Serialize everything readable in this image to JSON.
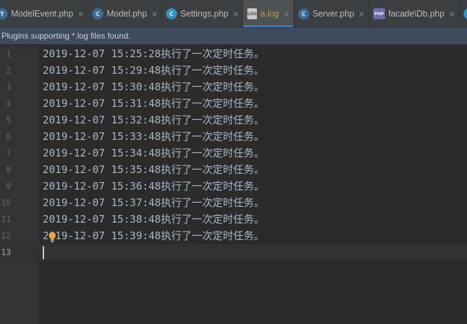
{
  "tabs": [
    {
      "label": "ModelEvent.php",
      "icon": "php-class-icon",
      "badge": "T",
      "active": false
    },
    {
      "label": "Model.php",
      "icon": "php-class-icon",
      "badge": "C",
      "active": false
    },
    {
      "label": "Settings.php",
      "icon": "c-class-icon",
      "badge": "C",
      "active": false
    },
    {
      "label": "a.log",
      "icon": "log-file-icon",
      "badge": "LOG",
      "active": true
    },
    {
      "label": "Server.php",
      "icon": "php-class-icon",
      "badge": "C",
      "active": false
    },
    {
      "label": "facade\\Db.php",
      "icon": "php-file-icon",
      "badge": "PHP",
      "active": false
    },
    {
      "label": "",
      "icon": "c-class-icon",
      "badge": "C",
      "active": false
    }
  ],
  "tab_close_glyph": "×",
  "banner": {
    "text": "Plugins supporting *.log files found."
  },
  "editor": {
    "line_numbers": [
      "1",
      "2",
      "3",
      "4",
      "5",
      "6",
      "7",
      "8",
      "9",
      "10",
      "11",
      "12",
      "13"
    ],
    "current_line": "13",
    "lines": [
      "2019-12-07 15:25:28执行了一次定时任务。",
      "2019-12-07 15:29:48执行了一次定时任务。",
      "2019-12-07 15:30:48执行了一次定时任务。",
      "2019-12-07 15:31:48执行了一次定时任务。",
      "2019-12-07 15:32:48执行了一次定时任务。",
      "2019-12-07 15:33:48执行了一次定时任务。",
      "2019-12-07 15:34:48执行了一次定时任务。",
      "2019-12-07 15:35:48执行了一次定时任务。",
      "2019-12-07 15:36:48执行了一次定时任务。",
      "2019-12-07 15:37:48执行了一次定时任务。",
      "2019-12-07 15:38:48执行了一次定时任务。",
      "2019-12-07 15:39:48执行了一次定时任务。",
      ""
    ]
  },
  "colors": {
    "accent": "#4a88c7",
    "active_tab_text": "#b8a14a",
    "bulb": "#e8a33d"
  }
}
